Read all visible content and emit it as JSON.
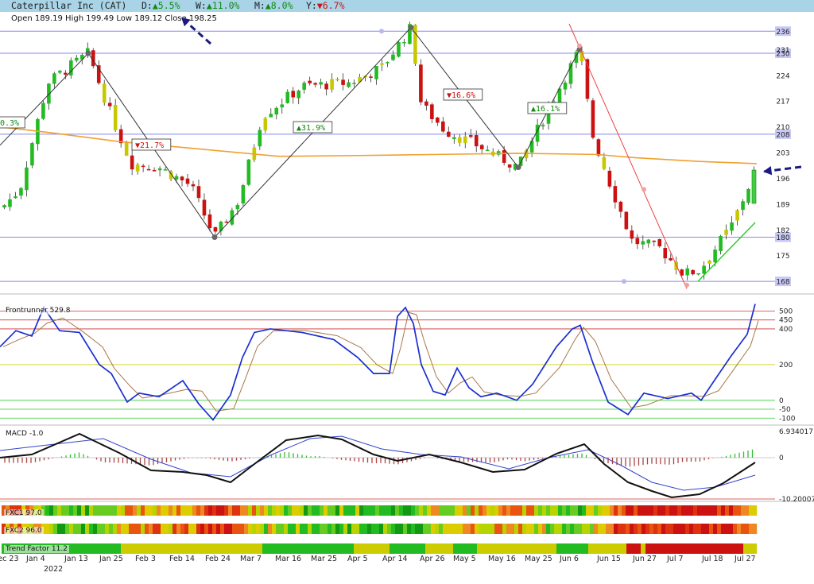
{
  "header": {
    "title": "Caterpillar Inc (CAT)",
    "perf": [
      {
        "label": "D:",
        "dir": "▲",
        "value": "5.5%"
      },
      {
        "label": "W:",
        "dir": "▲",
        "value": "11.0%"
      },
      {
        "label": "M:",
        "dir": "▲",
        "value": "8.0%"
      },
      {
        "label": "Y:",
        "dir": "▼",
        "value": "6.7%"
      }
    ],
    "ohlc": "Open 189.19 High 199.49 Low 189.12 Close 198.25"
  },
  "chart_data": [
    {
      "type": "candlestick",
      "title": "Caterpillar Inc (CAT)",
      "ylim": [
        165,
        238
      ],
      "y_ticks": [
        168,
        175,
        180,
        182,
        189,
        196,
        203,
        208,
        210,
        217,
        224,
        230,
        231,
        236
      ],
      "highlighted_levels": [
        236,
        230,
        208,
        180,
        168
      ],
      "x_tick_labels": [
        "Dec 23",
        "Jan 4",
        "Jan 13",
        "Jan 25",
        "Feb 3",
        "Feb 14",
        "Feb 24",
        "Mar 7",
        "Mar 16",
        "Mar 25",
        "Apr 5",
        "Apr 14",
        "Apr 26",
        "May 5",
        "May 16",
        "May 25",
        "Jun 6",
        "Jun 15",
        "Jun 27",
        "Jul 7",
        "Jul 18",
        "Jul 27"
      ],
      "year_label": "2022",
      "swing_points": [
        {
          "date": "Jan 13",
          "price": 230
        },
        {
          "date": "Feb 24",
          "price": 180
        },
        {
          "date": "Apr 21",
          "price": 237
        },
        {
          "date": "May 24",
          "price": 199
        },
        {
          "date": "Jun 8",
          "price": 231
        }
      ],
      "swing_labels": [
        "0.3%",
        "▼21.7%",
        "▲31.9%",
        "▼16.6%",
        "▲16.1%"
      ],
      "moving_average_color": "#f0a030",
      "last_close": 198.25
    },
    {
      "type": "line",
      "name": "Frontrunner",
      "label": "Frontrunner 529.8",
      "ylim": [
        -130,
        560
      ],
      "y_ticks": [
        500,
        450,
        400,
        200,
        0,
        -50,
        -100
      ],
      "last_value": 529.8
    },
    {
      "type": "line+bar",
      "name": "MACD",
      "label": "MACD -1.0",
      "y_tick_labels": [
        "6.934017",
        "0",
        "-10.20007"
      ]
    },
    {
      "type": "heatmap",
      "rows": [
        {
          "label": "FXC1 97.0"
        },
        {
          "label": "FXC2 96.0"
        },
        {
          "label": "Trend Factor 11.2"
        }
      ]
    }
  ],
  "colors": {
    "up": "#22bb22",
    "down": "#cc1111",
    "neutral": "#c8c800",
    "frontrunner": "#1a2fd0",
    "macd": "#111111",
    "signal": "#3344cc",
    "trendline_down": "#ee4444",
    "trendline_up": "#22cc22",
    "header_bg": "#a9d3e6"
  }
}
